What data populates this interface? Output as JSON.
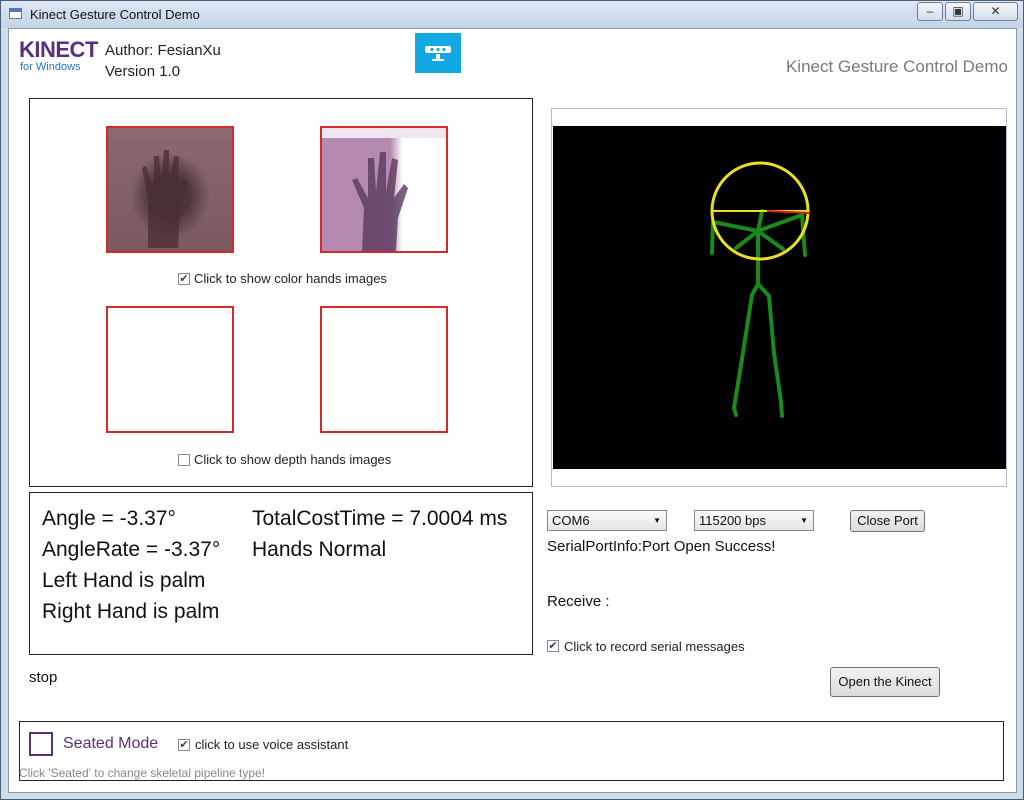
{
  "window": {
    "title": "Kinect Gesture Control Demo",
    "minimize_glyph": "‒",
    "maximize_glyph": "▣",
    "close_glyph": "✕"
  },
  "header": {
    "logo_kinect": "KINECT",
    "logo_sub": "for Windows",
    "author": "Author: FesianXu",
    "version": "Version 1.0",
    "app_title": "Kinect Gesture Control Demo",
    "kinect_icon": "kinect-sensor-icon"
  },
  "hands": {
    "color_checkbox_label": "Click to show color hands images",
    "color_checked": true,
    "depth_checkbox_label": "Click to show depth hands images",
    "depth_checked": false
  },
  "stats": {
    "angle": "Angle = -3.37°",
    "angle_rate": "AngleRate = -3.37°",
    "left_hand": "Left Hand is palm",
    "right_hand": "Right Hand is palm",
    "total_cost": "TotalCostTime = 7.0004 ms",
    "hands_status": "Hands Normal"
  },
  "status": "stop",
  "serial": {
    "port": "COM6",
    "baud": "115200 bps",
    "close_port": "Close Port",
    "info": "SerialPortInfo:Port Open Success!",
    "receive_label": "Receive :",
    "record_label": "Click to record serial messages",
    "record_checked": true
  },
  "open_kinect": "Open the Kinect",
  "footer": {
    "seated_mode": "Seated Mode",
    "voice_label": "click to use voice assistant",
    "voice_checked": true,
    "hint": "Click 'Seated' to change skeletal pipeline type!"
  },
  "colors": {
    "accent": "#5b2e7e",
    "kinect_blue": "#12a9e3",
    "hand_border": "#d42a2a",
    "skeleton_bone": "#1a8a1a",
    "head_circle": "#e8e020"
  }
}
